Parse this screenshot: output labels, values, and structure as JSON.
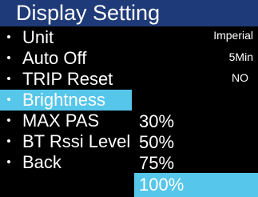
{
  "header": {
    "title": "Display Setting"
  },
  "menu": {
    "bullet": "•",
    "items": [
      {
        "label": "Unit",
        "value": "Imperial"
      },
      {
        "label": "Auto Off",
        "value": "5Min"
      },
      {
        "label": "TRIP Reset",
        "value": "NO"
      },
      {
        "label": "Brightness",
        "value": ""
      },
      {
        "label": "MAX PAS",
        "value": ""
      },
      {
        "label": "BT Rssi Level",
        "value": ""
      },
      {
        "label": "Back",
        "value": ""
      }
    ],
    "selected_label": "Brightness"
  },
  "brightness_dropdown": {
    "options": [
      "30%",
      "50%",
      "75%",
      "100%"
    ],
    "selected": "100%"
  },
  "colors": {
    "background": "#000000",
    "title_bar": "#1f3a78",
    "highlight": "#56c6ea",
    "text": "#ffffff"
  }
}
